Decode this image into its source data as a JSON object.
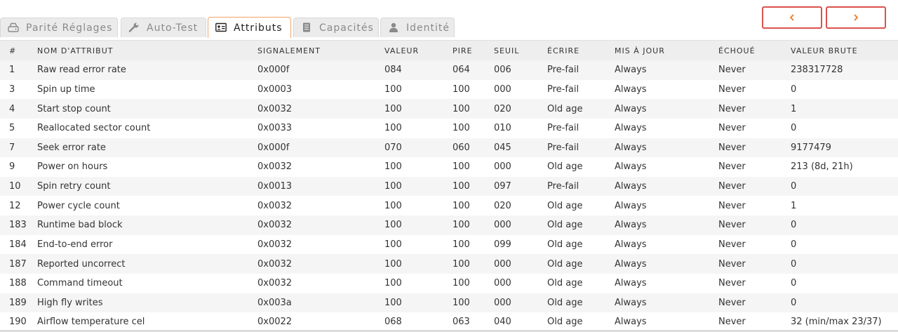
{
  "tabs": [
    {
      "label": "Parité Réglages",
      "icon": "hdd-icon",
      "active": false
    },
    {
      "label": "Auto-Test",
      "icon": "wrench-icon",
      "active": false
    },
    {
      "label": "Attributs",
      "icon": "id-card-icon",
      "active": true
    },
    {
      "label": "Capacités",
      "icon": "server-icon",
      "active": false
    },
    {
      "label": "Identité",
      "icon": "user-icon",
      "active": false
    }
  ],
  "nav": {
    "prev_icon": "chevron-left-icon",
    "next_icon": "chevron-right-icon"
  },
  "colors": {
    "accent": "#f0a46a",
    "nav_border": "#d9534f",
    "nav_arrow": "#e8873a",
    "row_stripe": "#f5f5f5",
    "header_bg": "#eeeeee"
  },
  "table": {
    "columns": [
      "#",
      "NOM D'ATTRIBUT",
      "SIGNALEMENT",
      "VALEUR",
      "PIRE",
      "SEUIL",
      "ÉCRIRE",
      "MIS À JOUR",
      "ÉCHOUÉ",
      "VALEUR BRUTE"
    ],
    "rows": [
      [
        "1",
        "Raw read error rate",
        "0x000f",
        "084",
        "064",
        "006",
        "Pre-fail",
        "Always",
        "Never",
        "238317728"
      ],
      [
        "3",
        "Spin up time",
        "0x0003",
        "100",
        "100",
        "000",
        "Pre-fail",
        "Always",
        "Never",
        "0"
      ],
      [
        "4",
        "Start stop count",
        "0x0032",
        "100",
        "100",
        "020",
        "Old age",
        "Always",
        "Never",
        "1"
      ],
      [
        "5",
        "Reallocated sector count",
        "0x0033",
        "100",
        "100",
        "010",
        "Pre-fail",
        "Always",
        "Never",
        "0"
      ],
      [
        "7",
        "Seek error rate",
        "0x000f",
        "070",
        "060",
        "045",
        "Pre-fail",
        "Always",
        "Never",
        "9177479"
      ],
      [
        "9",
        "Power on hours",
        "0x0032",
        "100",
        "100",
        "000",
        "Old age",
        "Always",
        "Never",
        "213 (8d, 21h)"
      ],
      [
        "10",
        "Spin retry count",
        "0x0013",
        "100",
        "100",
        "097",
        "Pre-fail",
        "Always",
        "Never",
        "0"
      ],
      [
        "12",
        "Power cycle count",
        "0x0032",
        "100",
        "100",
        "020",
        "Old age",
        "Always",
        "Never",
        "1"
      ],
      [
        "183",
        "Runtime bad block",
        "0x0032",
        "100",
        "100",
        "000",
        "Old age",
        "Always",
        "Never",
        "0"
      ],
      [
        "184",
        "End-to-end error",
        "0x0032",
        "100",
        "100",
        "099",
        "Old age",
        "Always",
        "Never",
        "0"
      ],
      [
        "187",
        "Reported uncorrect",
        "0x0032",
        "100",
        "100",
        "000",
        "Old age",
        "Always",
        "Never",
        "0"
      ],
      [
        "188",
        "Command timeout",
        "0x0032",
        "100",
        "100",
        "000",
        "Old age",
        "Always",
        "Never",
        "0"
      ],
      [
        "189",
        "High fly writes",
        "0x003a",
        "100",
        "100",
        "000",
        "Old age",
        "Always",
        "Never",
        "0"
      ],
      [
        "190",
        "Airflow temperature cel",
        "0x0022",
        "068",
        "063",
        "040",
        "Old age",
        "Always",
        "Never",
        "32 (min/max 23/37)"
      ]
    ]
  }
}
